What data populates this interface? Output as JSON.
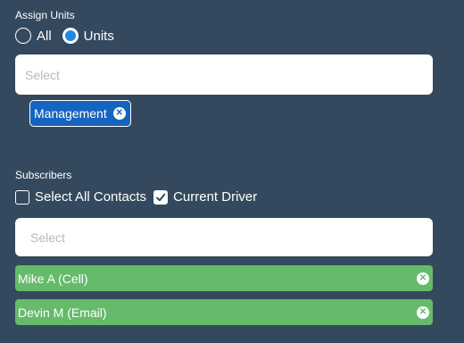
{
  "assign_units": {
    "label": "Assign Units",
    "radio_all": "All",
    "radio_units": "Units",
    "selected": "Units",
    "select_placeholder": "Select",
    "tags": [
      {
        "label": "Management",
        "remove_icon": "close-circle-icon"
      }
    ],
    "accent": "#1e88e5"
  },
  "subscribers": {
    "label": "Subscribers",
    "select_all_contacts": "Select All Contacts",
    "select_all_checked": false,
    "current_driver": "Current Driver",
    "current_driver_checked": true,
    "select_placeholder": "Select",
    "chips": [
      {
        "label": "Mike A (Cell)",
        "remove_icon": "close-circle-icon"
      },
      {
        "label": "Devin M (Email)",
        "remove_icon": "close-circle-icon"
      }
    ],
    "chip_color": "#66bb6a"
  },
  "background": "#34495e"
}
